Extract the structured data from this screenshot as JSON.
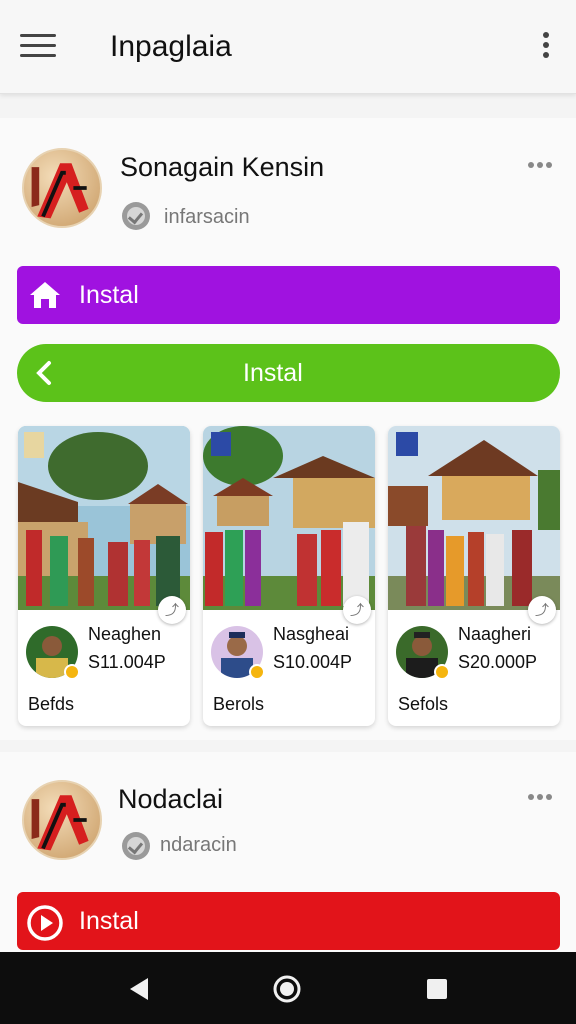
{
  "app_title": "Inpaglaia",
  "profile1": {
    "name": "Sonagain Kensin",
    "subtitle": "infarsacin",
    "install_purple": "Instal",
    "install_green": "Instal"
  },
  "tiles": [
    {
      "name": "Neaghen",
      "price": "S11.004P",
      "caption": "Befds"
    },
    {
      "name": "Nasgheai",
      "price": "S10.004P",
      "caption": "Berols"
    },
    {
      "name": "Naagheri",
      "price": "S20.000P",
      "caption": "Sefols"
    }
  ],
  "profile2": {
    "name": "Nodaclai",
    "subtitle": "ndaracin",
    "install_red": "Instal"
  },
  "icons": [
    "menu-icon",
    "more-vert-icon",
    "verified-icon",
    "more-horiz-icon",
    "home-icon",
    "chevron-left-icon",
    "play-circle-icon",
    "share-icon",
    "back-triangle-icon",
    "home-circle-icon",
    "recents-square-icon"
  ],
  "colors": {
    "purple": "#a012e0",
    "green": "#5cc21a",
    "red": "#e2141a"
  }
}
